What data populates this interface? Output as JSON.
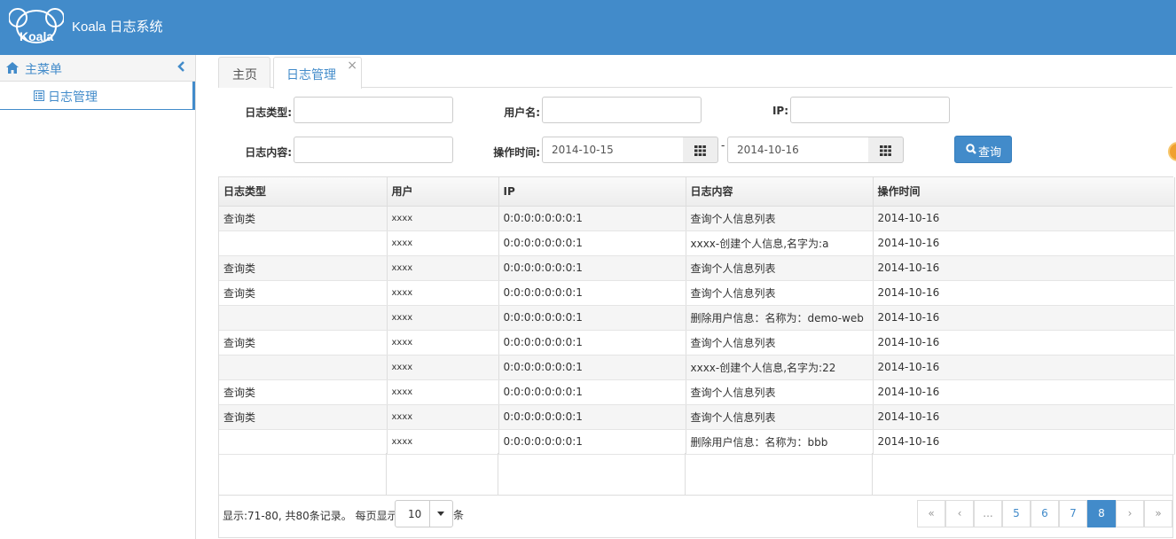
{
  "app": {
    "title": "Koala 日志系统",
    "logo_text": "Koala"
  },
  "sidebar": {
    "header_label": "主菜单",
    "items": [
      {
        "label": "日志管理"
      }
    ]
  },
  "tabs": [
    {
      "label": "主页"
    },
    {
      "label": "日志管理",
      "close": "×"
    }
  ],
  "filters": {
    "log_type_label": "日志类型:",
    "username_label": "用户名:",
    "ip_label": "IP:",
    "log_content_label": "日志内容:",
    "op_time_label": "操作时间:",
    "start_date": "2014-10-15",
    "end_date": "2014-10-16",
    "separator": "-",
    "search_label": "查询"
  },
  "table": {
    "headers": [
      "日志类型",
      "用户",
      "IP",
      "日志内容",
      "操作时间"
    ],
    "rows": [
      [
        "查询类",
        "xxxx",
        "0:0:0:0:0:0:0:1",
        "查询个人信息列表",
        "2014-10-16"
      ],
      [
        "",
        "xxxx",
        "0:0:0:0:0:0:0:1",
        "xxxx-创建个人信息,名字为:a",
        "2014-10-16"
      ],
      [
        "查询类",
        "xxxx",
        "0:0:0:0:0:0:0:1",
        "查询个人信息列表",
        "2014-10-16"
      ],
      [
        "查询类",
        "xxxx",
        "0:0:0:0:0:0:0:1",
        "查询个人信息列表",
        "2014-10-16"
      ],
      [
        "",
        "xxxx",
        "0:0:0:0:0:0:0:1",
        "删除用户信息：名称为：demo-web",
        "2014-10-16"
      ],
      [
        "查询类",
        "xxxx",
        "0:0:0:0:0:0:0:1",
        "查询个人信息列表",
        "2014-10-16"
      ],
      [
        "",
        "xxxx",
        "0:0:0:0:0:0:0:1",
        "xxxx-创建个人信息,名字为:22",
        "2014-10-16"
      ],
      [
        "查询类",
        "xxxx",
        "0:0:0:0:0:0:0:1",
        "查询个人信息列表",
        "2014-10-16"
      ],
      [
        "查询类",
        "xxxx",
        "0:0:0:0:0:0:0:1",
        "查询个人信息列表",
        "2014-10-16"
      ],
      [
        "",
        "xxxx",
        "0:0:0:0:0:0:0:1",
        "删除用户信息：名称为：bbb",
        "2014-10-16"
      ]
    ]
  },
  "footer": {
    "summary": "显示:71-80, 共80条记录。 每页显示:",
    "page_size": "10",
    "unit": "条",
    "pager": [
      "«",
      "‹",
      "...",
      "5",
      "6",
      "7",
      "8",
      "›",
      "»"
    ],
    "current_page": "8"
  },
  "colors": {
    "primary": "#428bca",
    "header_bg": "#428bca",
    "row_alt": "#f5f5f5"
  }
}
